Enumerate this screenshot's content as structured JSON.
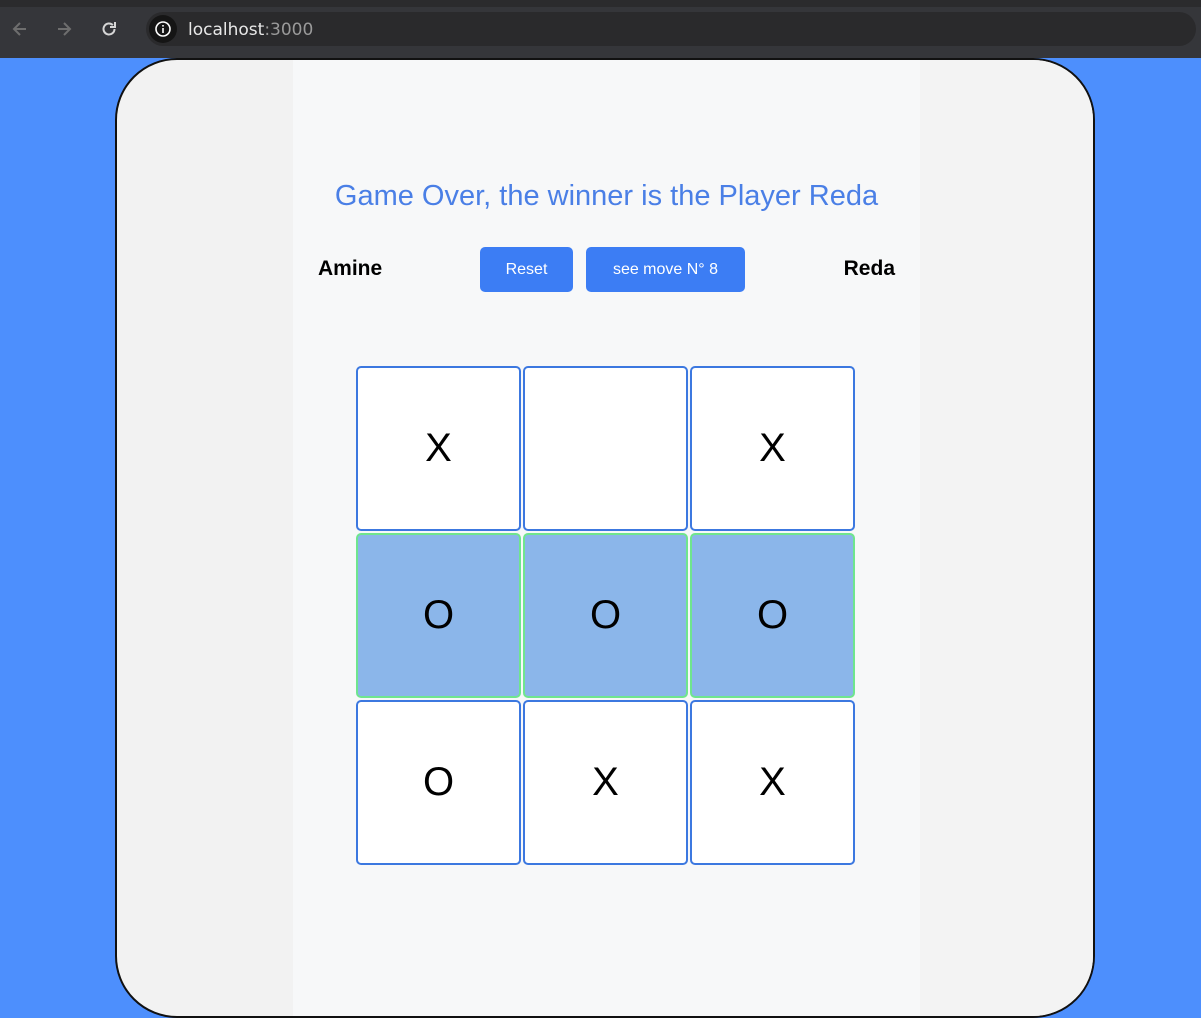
{
  "browser": {
    "url_host": "localhost",
    "url_port": ":3000"
  },
  "game": {
    "status_message": "Game Over, the winner is the Player Reda",
    "player_one": "Amine",
    "player_two": "Reda",
    "reset_label": "Reset",
    "move_label": "see move N° 8",
    "winning_cells": [
      3,
      4,
      5
    ],
    "cells": [
      "X",
      "",
      "X",
      "O",
      "O",
      "O",
      "O",
      "X",
      "X"
    ]
  },
  "colors": {
    "accent": "#3c7df4",
    "page_background": "#4d8ffd",
    "win_fill": "#8bb6ea",
    "win_border": "#6fe58e"
  }
}
